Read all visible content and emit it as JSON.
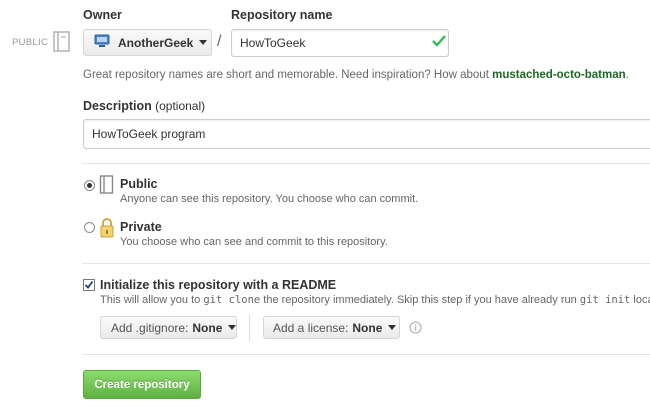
{
  "visibility_badge": "PUBLIC",
  "owner": {
    "label": "Owner",
    "selected": "AnotherGeek"
  },
  "repository": {
    "label": "Repository name",
    "value": "HowToGeek",
    "slash": "/"
  },
  "suggestion": {
    "text": "Great repository names are short and memorable. Need inspiration? How about ",
    "name": "mustached-octo-batman",
    "end": "."
  },
  "description": {
    "label": "Description",
    "optional": "(optional)",
    "value": "HowToGeek program"
  },
  "visibility": {
    "public": {
      "title": "Public",
      "text": "Anyone can see this repository. You choose who can commit.",
      "checked": true
    },
    "private": {
      "title": "Private",
      "text": "You choose who can see and commit to this repository.",
      "checked": false
    }
  },
  "readme": {
    "label": "Initialize this repository with a README",
    "checked": true,
    "text_1": "This will allow you to ",
    "code_1": "git clone",
    "text_2": " the repository immediately. Skip this step if you have already run ",
    "code_2": "git init",
    "text_3": " locally."
  },
  "gitignore": {
    "prefix": "Add .gitignore:",
    "value": "None"
  },
  "license": {
    "prefix": "Add a license:",
    "value": "None"
  },
  "submit_label": "Create repository",
  "colors": {
    "success": "#2cbe4e",
    "suggestion": "#1e6823",
    "button_top": "#8add6d",
    "button_bottom": "#60b044"
  }
}
